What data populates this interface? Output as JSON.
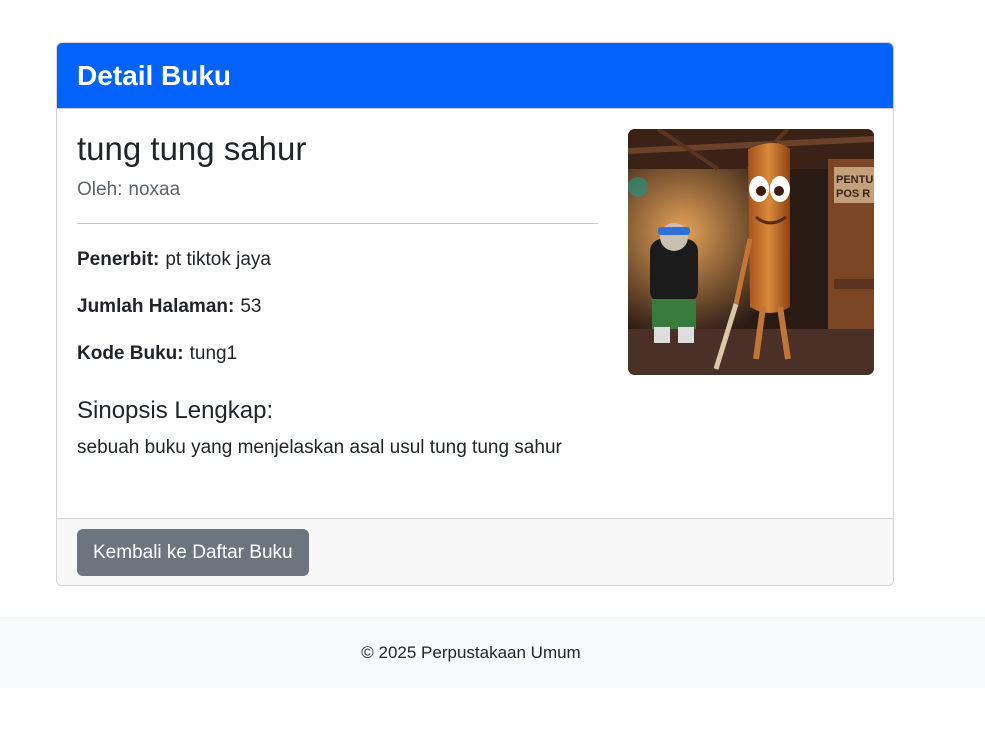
{
  "card": {
    "header_title": "Detail Buku"
  },
  "book": {
    "title": "tung tung sahur",
    "author_label": "Oleh:",
    "author": "noxaa",
    "fields": [
      {
        "label": "Penerbit:",
        "value": "pt tiktok jaya"
      },
      {
        "label": "Jumlah Halaman:",
        "value": "53"
      },
      {
        "label": "Kode Buku:",
        "value": "tung1"
      }
    ],
    "synopsis_heading": "Sinopsis Lengkap:",
    "synopsis": "sebuah buku yang menjelaskan asal usul tung tung sahur",
    "cover_sign_text": "PENTU POS R"
  },
  "actions": {
    "back_label": "Kembali ke Daftar Buku"
  },
  "footer": {
    "text": "© 2025 Perpustakaan Umum"
  },
  "colors": {
    "header": "#0362fc",
    "button": "#6c757d",
    "footer_bg": "#f8f9fa"
  }
}
